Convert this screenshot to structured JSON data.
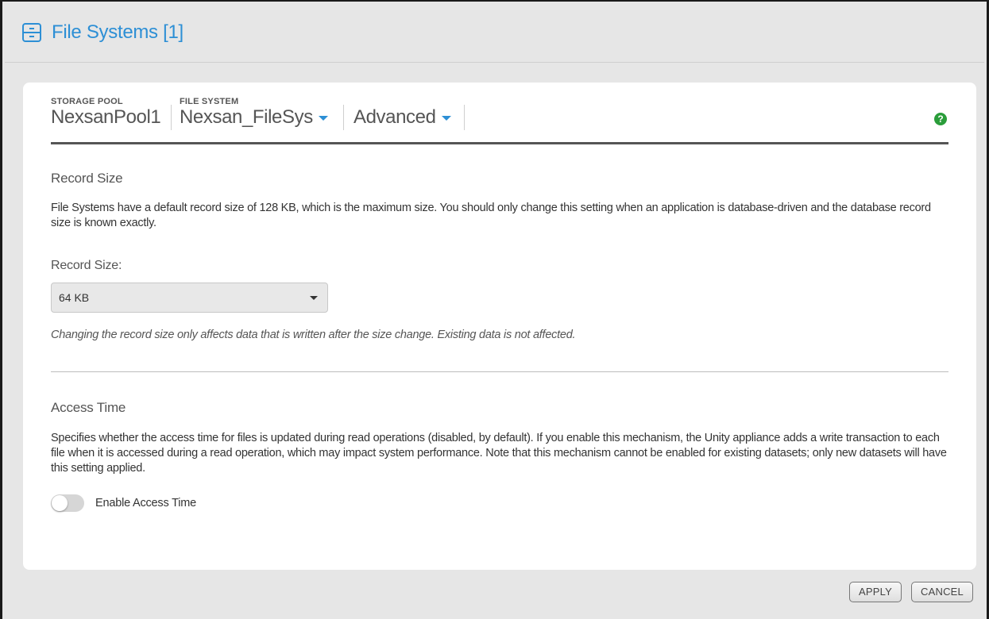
{
  "header": {
    "title": "File Systems [1]",
    "icon": "file-cabinet-icon"
  },
  "breadcrumb": {
    "storage_pool_caption": "STORAGE POOL",
    "storage_pool_value": "NexsanPool1",
    "file_system_caption": "FILE SYSTEM",
    "file_system_value": "Nexsan_FileSys",
    "view_value": "Advanced",
    "accent_color": "#2d8fd5"
  },
  "help": {
    "icon": "question-circle-icon",
    "glyph": "?",
    "color": "#2a9d3a"
  },
  "record_size": {
    "title": "Record Size",
    "description": "File Systems have a default record size of 128 KB, which is the maximum size. You should only change this setting when an application is database-driven and the database record size is known exactly.",
    "label": "Record Size:",
    "selected": "64 KB",
    "note": "Changing the record size only affects data that is written after the size change. Existing data is not affected."
  },
  "access_time": {
    "title": "Access Time",
    "description": "Specifies whether the access time for files is updated during read operations (disabled, by default). If you enable this mechanism, the Unity appliance adds a write transaction to each file when it is accessed during a read operation, which may impact system performance. Note that this mechanism cannot be enabled for existing datasets; only new datasets will have this setting applied.",
    "toggle_label": "Enable Access Time",
    "enabled": false
  },
  "actions": {
    "apply_label": "APPLY",
    "cancel_label": "CANCEL"
  }
}
